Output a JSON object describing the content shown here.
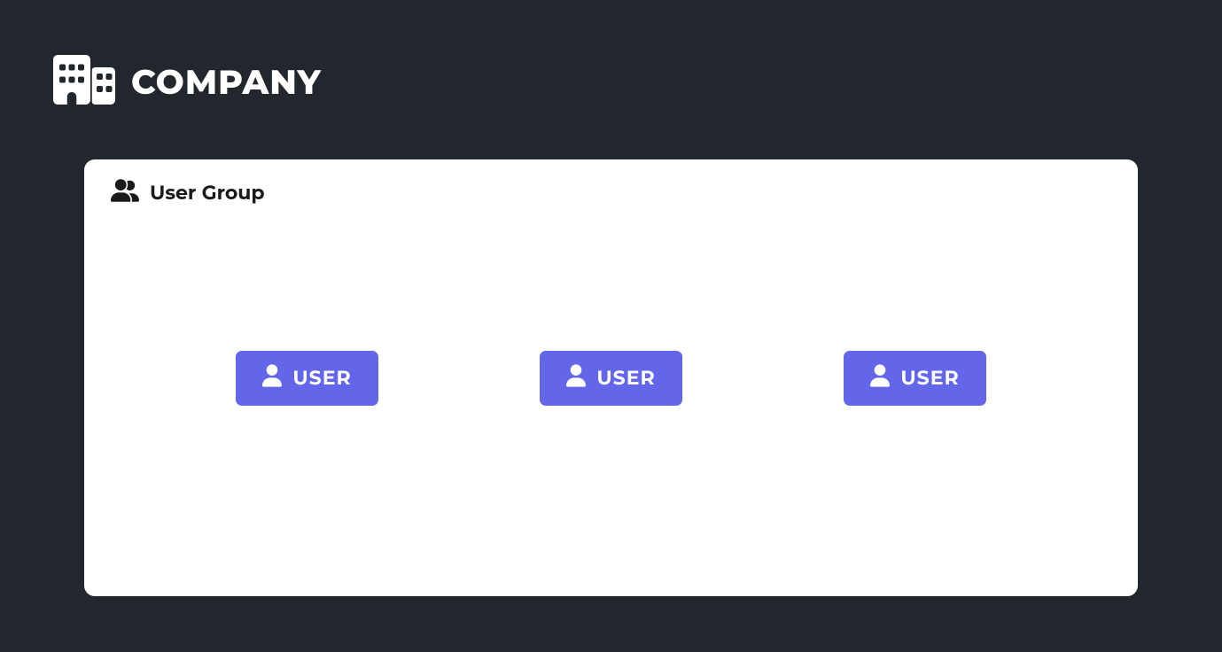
{
  "header": {
    "title": "COMPANY"
  },
  "card": {
    "title": "User Group",
    "users": [
      {
        "label": "USER"
      },
      {
        "label": "USER"
      },
      {
        "label": "USER"
      }
    ]
  },
  "colors": {
    "background": "#22272e",
    "card_bg": "#ffffff",
    "accent": "#6366e8",
    "text_light": "#ffffff",
    "text_dark": "#1a1a1a"
  }
}
